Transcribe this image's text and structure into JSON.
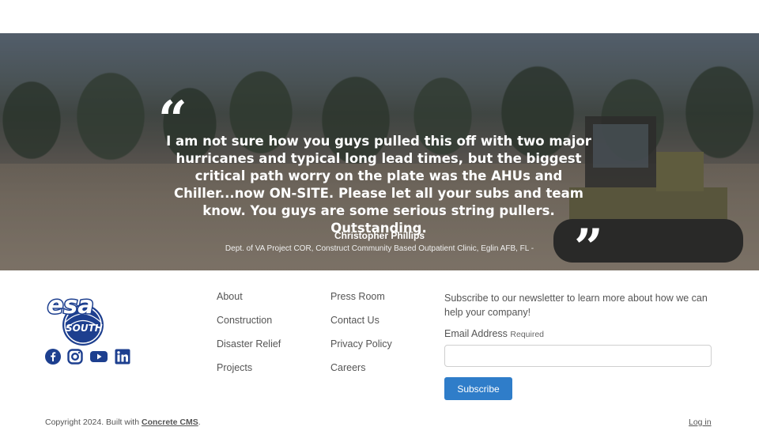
{
  "testimonial": {
    "open_quote": "“",
    "close_quote": "”",
    "text": "I am not sure how you guys pulled this off with two major hurricanes and typical long lead times, but the biggest critical path worry on the plate was the AHUs and Chiller...now ON-SITE. Please let all your subs and team know. You guys are some serious string pullers. Outstanding.",
    "author": "Christopher Phillips",
    "role": "Dept. of VA Project COR, Construct Community Based Outpatient Clinic, Eglin AFB, FL -"
  },
  "logo": {
    "text_top": "esa",
    "text_bottom": "SOUTH",
    "color": "#1d3f8f"
  },
  "social": [
    {
      "icon": "facebook-icon"
    },
    {
      "icon": "instagram-icon"
    },
    {
      "icon": "youtube-icon"
    },
    {
      "icon": "linkedin-icon"
    }
  ],
  "nav": {
    "col1": [
      "About",
      "Construction",
      "Disaster Relief",
      "Projects"
    ],
    "col2": [
      "Press Room",
      "Contact Us",
      "Privacy Policy",
      "Careers"
    ]
  },
  "newsletter": {
    "intro": "Subscribe to our newsletter to learn more about how we can help your company!",
    "email_label": "Email Address",
    "required": "Required",
    "email_value": "",
    "button": "Subscribe",
    "button_color": "#2f7dc9"
  },
  "footer": {
    "copyright_prefix": "Copyright 2024. Built with ",
    "cms_link": "Concrete CMS",
    "copyright_suffix": ".",
    "login": "Log in"
  }
}
